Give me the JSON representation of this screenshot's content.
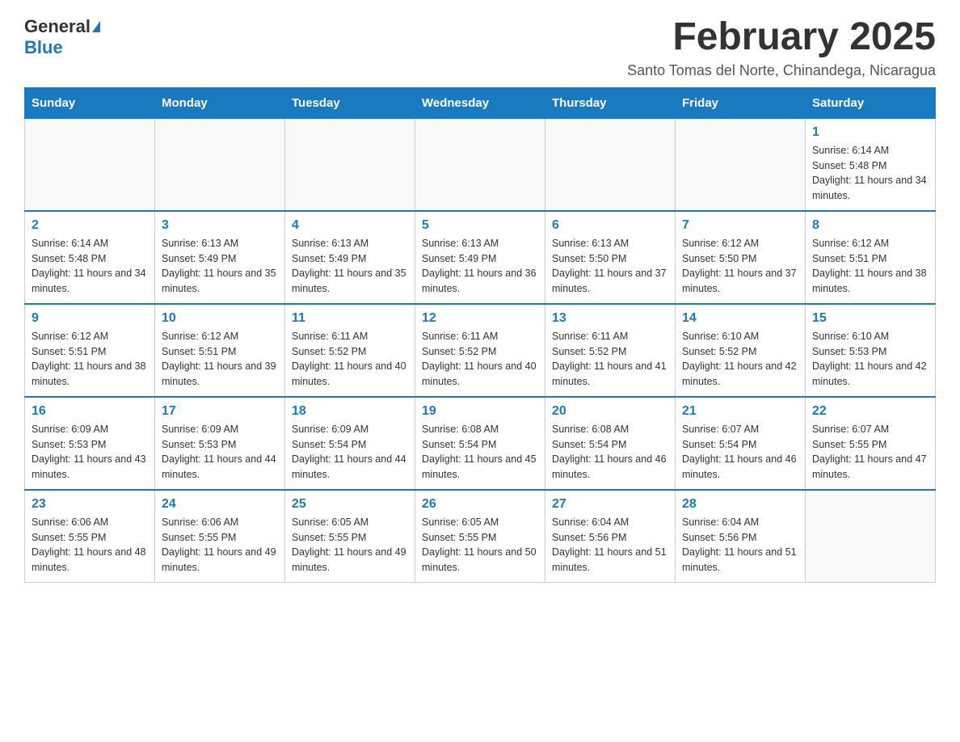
{
  "header": {
    "logo_main": "General",
    "logo_accent": "Blue",
    "month_title": "February 2025",
    "location": "Santo Tomas del Norte, Chinandega, Nicaragua"
  },
  "weekdays": [
    "Sunday",
    "Monday",
    "Tuesday",
    "Wednesday",
    "Thursday",
    "Friday",
    "Saturday"
  ],
  "weeks": [
    [
      {
        "day": "",
        "info": ""
      },
      {
        "day": "",
        "info": ""
      },
      {
        "day": "",
        "info": ""
      },
      {
        "day": "",
        "info": ""
      },
      {
        "day": "",
        "info": ""
      },
      {
        "day": "",
        "info": ""
      },
      {
        "day": "1",
        "info": "Sunrise: 6:14 AM\nSunset: 5:48 PM\nDaylight: 11 hours and 34 minutes."
      }
    ],
    [
      {
        "day": "2",
        "info": "Sunrise: 6:14 AM\nSunset: 5:48 PM\nDaylight: 11 hours and 34 minutes."
      },
      {
        "day": "3",
        "info": "Sunrise: 6:13 AM\nSunset: 5:49 PM\nDaylight: 11 hours and 35 minutes."
      },
      {
        "day": "4",
        "info": "Sunrise: 6:13 AM\nSunset: 5:49 PM\nDaylight: 11 hours and 35 minutes."
      },
      {
        "day": "5",
        "info": "Sunrise: 6:13 AM\nSunset: 5:49 PM\nDaylight: 11 hours and 36 minutes."
      },
      {
        "day": "6",
        "info": "Sunrise: 6:13 AM\nSunset: 5:50 PM\nDaylight: 11 hours and 37 minutes."
      },
      {
        "day": "7",
        "info": "Sunrise: 6:12 AM\nSunset: 5:50 PM\nDaylight: 11 hours and 37 minutes."
      },
      {
        "day": "8",
        "info": "Sunrise: 6:12 AM\nSunset: 5:51 PM\nDaylight: 11 hours and 38 minutes."
      }
    ],
    [
      {
        "day": "9",
        "info": "Sunrise: 6:12 AM\nSunset: 5:51 PM\nDaylight: 11 hours and 38 minutes."
      },
      {
        "day": "10",
        "info": "Sunrise: 6:12 AM\nSunset: 5:51 PM\nDaylight: 11 hours and 39 minutes."
      },
      {
        "day": "11",
        "info": "Sunrise: 6:11 AM\nSunset: 5:52 PM\nDaylight: 11 hours and 40 minutes."
      },
      {
        "day": "12",
        "info": "Sunrise: 6:11 AM\nSunset: 5:52 PM\nDaylight: 11 hours and 40 minutes."
      },
      {
        "day": "13",
        "info": "Sunrise: 6:11 AM\nSunset: 5:52 PM\nDaylight: 11 hours and 41 minutes."
      },
      {
        "day": "14",
        "info": "Sunrise: 6:10 AM\nSunset: 5:52 PM\nDaylight: 11 hours and 42 minutes."
      },
      {
        "day": "15",
        "info": "Sunrise: 6:10 AM\nSunset: 5:53 PM\nDaylight: 11 hours and 42 minutes."
      }
    ],
    [
      {
        "day": "16",
        "info": "Sunrise: 6:09 AM\nSunset: 5:53 PM\nDaylight: 11 hours and 43 minutes."
      },
      {
        "day": "17",
        "info": "Sunrise: 6:09 AM\nSunset: 5:53 PM\nDaylight: 11 hours and 44 minutes."
      },
      {
        "day": "18",
        "info": "Sunrise: 6:09 AM\nSunset: 5:54 PM\nDaylight: 11 hours and 44 minutes."
      },
      {
        "day": "19",
        "info": "Sunrise: 6:08 AM\nSunset: 5:54 PM\nDaylight: 11 hours and 45 minutes."
      },
      {
        "day": "20",
        "info": "Sunrise: 6:08 AM\nSunset: 5:54 PM\nDaylight: 11 hours and 46 minutes."
      },
      {
        "day": "21",
        "info": "Sunrise: 6:07 AM\nSunset: 5:54 PM\nDaylight: 11 hours and 46 minutes."
      },
      {
        "day": "22",
        "info": "Sunrise: 6:07 AM\nSunset: 5:55 PM\nDaylight: 11 hours and 47 minutes."
      }
    ],
    [
      {
        "day": "23",
        "info": "Sunrise: 6:06 AM\nSunset: 5:55 PM\nDaylight: 11 hours and 48 minutes."
      },
      {
        "day": "24",
        "info": "Sunrise: 6:06 AM\nSunset: 5:55 PM\nDaylight: 11 hours and 49 minutes."
      },
      {
        "day": "25",
        "info": "Sunrise: 6:05 AM\nSunset: 5:55 PM\nDaylight: 11 hours and 49 minutes."
      },
      {
        "day": "26",
        "info": "Sunrise: 6:05 AM\nSunset: 5:55 PM\nDaylight: 11 hours and 50 minutes."
      },
      {
        "day": "27",
        "info": "Sunrise: 6:04 AM\nSunset: 5:56 PM\nDaylight: 11 hours and 51 minutes."
      },
      {
        "day": "28",
        "info": "Sunrise: 6:04 AM\nSunset: 5:56 PM\nDaylight: 11 hours and 51 minutes."
      },
      {
        "day": "",
        "info": ""
      }
    ]
  ],
  "accent_color": "#1a7abf"
}
